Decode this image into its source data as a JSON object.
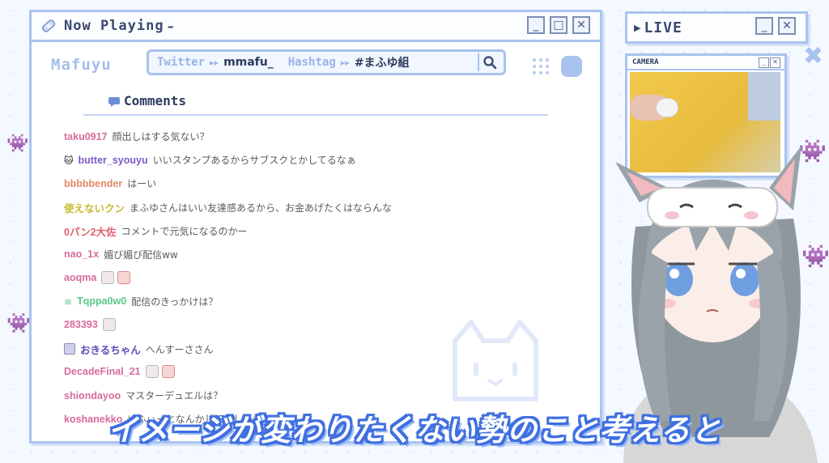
{
  "main_window": {
    "title": "Now Playing",
    "channel_name": "Mafuyu",
    "twitter_label": "Twitter",
    "twitter_handle": "mmafu_",
    "hashtag_label": "Hashtag",
    "hashtag_value": "#まふゆ組",
    "comments_header": "Comments",
    "buttons": {
      "minimize": "_",
      "maximize": "□",
      "close": "✕"
    }
  },
  "live_window": {
    "title": "LIVE",
    "buttons": {
      "minimize": "_",
      "close": "✕"
    }
  },
  "camera_window": {
    "title": "CAMERA",
    "buttons": {
      "minimize": "_",
      "close": "✕"
    }
  },
  "comments": [
    {
      "user": "taku0917",
      "text": "顔出しはする気ない？",
      "color": "#d76b9a",
      "badge": "none"
    },
    {
      "user": "butter_syouyu",
      "text": "いいスタンプあるからサブスクとかしてるなぁ",
      "color": "#7b5cc9",
      "badge": "cat"
    },
    {
      "user": "bbbbbender",
      "text": "はーい",
      "color": "#e28a6a",
      "badge": "none"
    },
    {
      "user": "使えないクン",
      "text": "まふゆさんはいい友達感あるから、お金あげたくはならんな",
      "color": "#c8b92a",
      "badge": "none"
    },
    {
      "user": "0パン2大佐",
      "text": "コメントで元気になるのかー",
      "color": "#e0606f",
      "badge": "none"
    },
    {
      "user": "nao_1x",
      "text": "媚び媚び配信ww",
      "color": "#d76b9a",
      "badge": "none"
    },
    {
      "user": "aoqma",
      "text": "",
      "color": "#d76b9a",
      "badge": "none",
      "emotes": 2
    },
    {
      "user": "Tqppa0w0",
      "text": "配信のきっかけは？",
      "color": "#58c98a",
      "badge": "wifi"
    },
    {
      "user": "283393",
      "text": "",
      "color": "#d76b9a",
      "badge": "none",
      "emotes": 1
    },
    {
      "user": "おきるちゃん",
      "text": "へんすーささん",
      "color": "#5a4fb8",
      "badge": "icon"
    },
    {
      "user": "DecadeFinal_21",
      "text": "",
      "color": "#d76b9a",
      "badge": "none",
      "emotes": 2
    },
    {
      "user": "shiondayoo",
      "text": "マスターデュエルは？",
      "color": "#d76b9a",
      "badge": "none"
    },
    {
      "user": "koshanekko",
      "text": "ゆふぃーとなんかしてほしいな！",
      "color": "#d76b9a",
      "badge": "none"
    }
  ],
  "subtitle": "イメージが変わりたくない勢のこと考えると",
  "colors": {
    "accent": "#aac3ee",
    "subtitle_outline": "#3f6fe0"
  },
  "icons": {
    "search": "search-icon",
    "comment": "speech-bubble-icon",
    "bandage": "bandage-icon"
  }
}
